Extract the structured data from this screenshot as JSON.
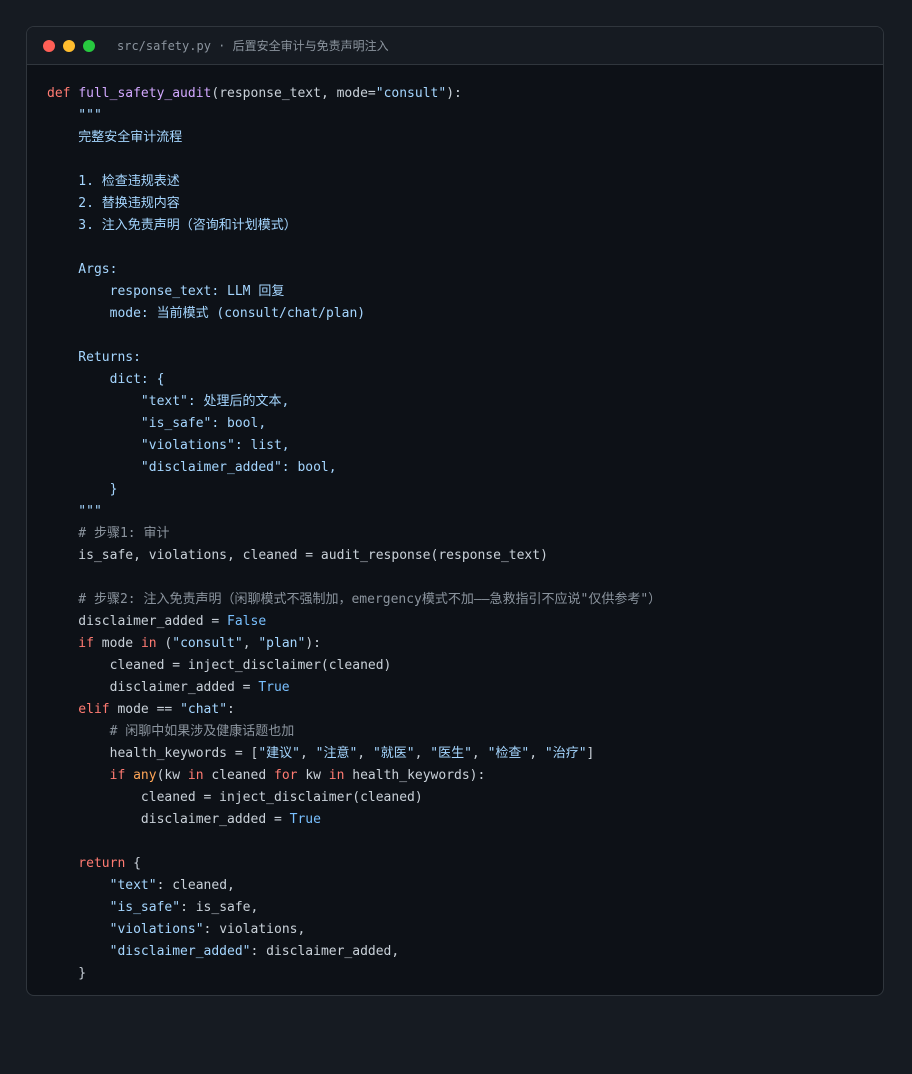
{
  "window": {
    "title": "src/safety.py · 后置安全审计与免责声明注入"
  },
  "colors": {
    "keyword": "#ff7b72",
    "function": "#d2a8ff",
    "string": "#a5d6ff",
    "constant": "#79c0ff",
    "builtin": "#ffa657",
    "comment": "#8b949e",
    "text": "#c9d1d9",
    "background": "#0d1117"
  },
  "code_lines": [
    [
      [
        "keyword",
        "def "
      ],
      [
        "func",
        "full_safety_audit"
      ],
      [
        "plain",
        "(response_text, mode="
      ],
      [
        "string",
        "\"consult\""
      ],
      [
        "plain",
        "):"
      ]
    ],
    [
      [
        "string",
        "    \"\"\""
      ]
    ],
    [
      [
        "string",
        "    完整安全审计流程"
      ]
    ],
    [
      [
        "string",
        ""
      ]
    ],
    [
      [
        "string",
        "    1. 检查违规表述"
      ]
    ],
    [
      [
        "string",
        "    2. 替换违规内容"
      ]
    ],
    [
      [
        "string",
        "    3. 注入免责声明（咨询和计划模式）"
      ]
    ],
    [
      [
        "string",
        ""
      ]
    ],
    [
      [
        "string",
        "    Args:"
      ]
    ],
    [
      [
        "string",
        "        response_text: LLM 回复"
      ]
    ],
    [
      [
        "string",
        "        mode: 当前模式 (consult/chat/plan)"
      ]
    ],
    [
      [
        "string",
        ""
      ]
    ],
    [
      [
        "string",
        "    Returns:"
      ]
    ],
    [
      [
        "string",
        "        dict: {"
      ]
    ],
    [
      [
        "string",
        "            \"text\": 处理后的文本,"
      ]
    ],
    [
      [
        "string",
        "            \"is_safe\": bool,"
      ]
    ],
    [
      [
        "string",
        "            \"violations\": list,"
      ]
    ],
    [
      [
        "string",
        "            \"disclaimer_added\": bool,"
      ]
    ],
    [
      [
        "string",
        "        }"
      ]
    ],
    [
      [
        "string",
        "    \"\"\""
      ]
    ],
    [
      [
        "comment",
        "    # 步骤1: 审计"
      ]
    ],
    [
      [
        "plain",
        "    is_safe, violations, cleaned = audit_response(response_text)"
      ]
    ],
    [
      [
        "plain",
        ""
      ]
    ],
    [
      [
        "comment",
        "    # 步骤2: 注入免责声明（闲聊模式不强制加，emergency模式不加——急救指引不应说\"仅供参考\"）"
      ]
    ],
    [
      [
        "plain",
        "    disclaimer_added = "
      ],
      [
        "const",
        "False"
      ]
    ],
    [
      [
        "keyword",
        "    if "
      ],
      [
        "plain",
        "mode "
      ],
      [
        "keyword",
        "in "
      ],
      [
        "plain",
        "("
      ],
      [
        "string",
        "\"consult\""
      ],
      [
        "plain",
        ", "
      ],
      [
        "string",
        "\"plan\""
      ],
      [
        "plain",
        "):"
      ]
    ],
    [
      [
        "plain",
        "        cleaned = inject_disclaimer(cleaned)"
      ]
    ],
    [
      [
        "plain",
        "        disclaimer_added = "
      ],
      [
        "const",
        "True"
      ]
    ],
    [
      [
        "keyword",
        "    elif "
      ],
      [
        "plain",
        "mode == "
      ],
      [
        "string",
        "\"chat\""
      ],
      [
        "plain",
        ":"
      ]
    ],
    [
      [
        "comment",
        "        # 闲聊中如果涉及健康话题也加"
      ]
    ],
    [
      [
        "plain",
        "        health_keywords = ["
      ],
      [
        "string",
        "\"建议\""
      ],
      [
        "plain",
        ", "
      ],
      [
        "string",
        "\"注意\""
      ],
      [
        "plain",
        ", "
      ],
      [
        "string",
        "\"就医\""
      ],
      [
        "plain",
        ", "
      ],
      [
        "string",
        "\"医生\""
      ],
      [
        "plain",
        ", "
      ],
      [
        "string",
        "\"检查\""
      ],
      [
        "plain",
        ", "
      ],
      [
        "string",
        "\"治疗\""
      ],
      [
        "plain",
        "]"
      ]
    ],
    [
      [
        "keyword",
        "        if "
      ],
      [
        "builtin",
        "any"
      ],
      [
        "plain",
        "(kw "
      ],
      [
        "keyword",
        "in "
      ],
      [
        "plain",
        "cleaned "
      ],
      [
        "keyword",
        "for "
      ],
      [
        "plain",
        "kw "
      ],
      [
        "keyword",
        "in "
      ],
      [
        "plain",
        "health_keywords):"
      ]
    ],
    [
      [
        "plain",
        "            cleaned = inject_disclaimer(cleaned)"
      ]
    ],
    [
      [
        "plain",
        "            disclaimer_added = "
      ],
      [
        "const",
        "True"
      ]
    ],
    [
      [
        "plain",
        ""
      ]
    ],
    [
      [
        "keyword",
        "    return "
      ],
      [
        "plain",
        "{"
      ]
    ],
    [
      [
        "string",
        "        \"text\""
      ],
      [
        "plain",
        ": cleaned,"
      ]
    ],
    [
      [
        "string",
        "        \"is_safe\""
      ],
      [
        "plain",
        ": is_safe,"
      ]
    ],
    [
      [
        "string",
        "        \"violations\""
      ],
      [
        "plain",
        ": violations,"
      ]
    ],
    [
      [
        "string",
        "        \"disclaimer_added\""
      ],
      [
        "plain",
        ": disclaimer_added,"
      ]
    ],
    [
      [
        "plain",
        "    }"
      ]
    ]
  ]
}
